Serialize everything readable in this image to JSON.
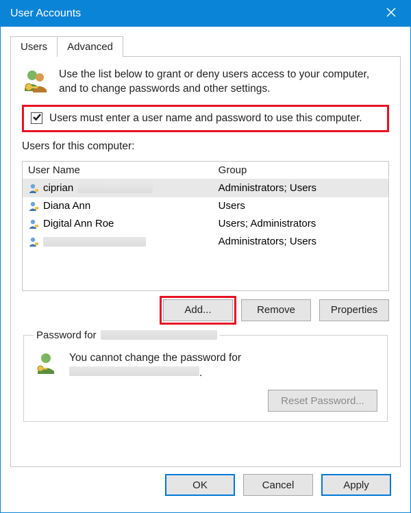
{
  "window": {
    "title": "User Accounts"
  },
  "tabs": [
    {
      "label": "Users",
      "active": true
    },
    {
      "label": "Advanced",
      "active": false
    }
  ],
  "intro": {
    "text": "Use the list below to grant or deny users access to your computer, and to change passwords and other settings."
  },
  "checkbox": {
    "checked": true,
    "label": "Users must enter a user name and password to use this computer."
  },
  "userlist": {
    "caption": "Users for this computer:",
    "columns": {
      "name": "User Name",
      "group": "Group"
    },
    "rows": [
      {
        "name": "ciprian",
        "redacted": true,
        "group": "Administrators; Users",
        "selected": true
      },
      {
        "name": "Diana Ann",
        "redacted": false,
        "group": "Users",
        "selected": false
      },
      {
        "name": "Digital Ann Roe",
        "redacted": false,
        "group": "Users; Administrators",
        "selected": false
      },
      {
        "name": "",
        "redacted": true,
        "group": "Administrators; Users",
        "selected": false
      }
    ]
  },
  "buttons": {
    "add": "Add...",
    "remove": "Remove",
    "properties": "Properties"
  },
  "password_box": {
    "legend_prefix": "Password for",
    "message_prefix": "You cannot change the password for",
    "message_suffix": ".",
    "reset": "Reset Password..."
  },
  "footer": {
    "ok": "OK",
    "cancel": "Cancel",
    "apply": "Apply"
  }
}
